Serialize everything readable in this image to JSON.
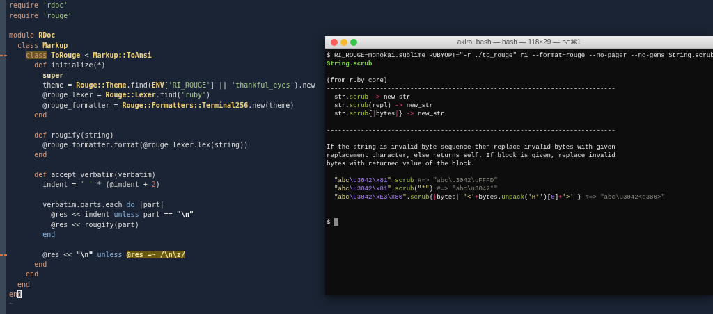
{
  "editor": {
    "lines": [
      {
        "kind": "code",
        "changed": false,
        "tokens": [
          {
            "text": "require",
            "kind": "keyword"
          },
          {
            "text": " 'rdoc'",
            "kind": "string"
          }
        ]
      },
      {
        "kind": "code",
        "changed": false,
        "tokens": [
          {
            "text": "require",
            "kind": "keyword"
          },
          {
            "text": " 'rouge'",
            "kind": "string"
          }
        ]
      },
      {
        "kind": "blank"
      },
      {
        "kind": "code",
        "changed": false,
        "tokens": [
          {
            "text": "module",
            "kind": "keyword"
          },
          {
            "text": " RDoc",
            "kind": "const"
          }
        ]
      },
      {
        "kind": "code",
        "changed": false,
        "tokens": [
          {
            "text": "  class",
            "kind": "keyword"
          },
          {
            "text": " Markup",
            "kind": "const"
          }
        ]
      },
      {
        "kind": "code",
        "changed": true,
        "tokens": [
          {
            "text": "    class",
            "kind": "match-keyword"
          },
          {
            "text": " ToRouge",
            "kind": "const"
          },
          {
            "text": " < ",
            "kind": "plain"
          },
          {
            "text": "Markup::ToAnsi",
            "kind": "const"
          }
        ]
      },
      {
        "kind": "code",
        "changed": false,
        "tokens": [
          {
            "text": "      def",
            "kind": "keyword"
          },
          {
            "text": " initialize(*)",
            "kind": "plain"
          }
        ]
      },
      {
        "kind": "code",
        "changed": false,
        "tokens": [
          {
            "text": "        super",
            "kind": "bold"
          }
        ]
      },
      {
        "kind": "code",
        "changed": false,
        "tokens": [
          {
            "text": "        theme = ",
            "kind": "plain"
          },
          {
            "text": "Rouge::Theme",
            "kind": "const"
          },
          {
            "text": ".find(",
            "kind": "plain"
          },
          {
            "text": "ENV",
            "kind": "const"
          },
          {
            "text": "[",
            "kind": "plain"
          },
          {
            "text": "'RI_ROUGE'",
            "kind": "string"
          },
          {
            "text": "] || ",
            "kind": "plain"
          },
          {
            "text": "'thankful_eyes'",
            "kind": "string"
          },
          {
            "text": ").new",
            "kind": "plain"
          }
        ]
      },
      {
        "kind": "code",
        "changed": false,
        "tokens": [
          {
            "text": "        @rouge_lexer = ",
            "kind": "plain"
          },
          {
            "text": "Rouge::Lexer",
            "kind": "const"
          },
          {
            "text": ".find(",
            "kind": "plain"
          },
          {
            "text": "'ruby'",
            "kind": "string"
          },
          {
            "text": ")",
            "kind": "plain"
          }
        ]
      },
      {
        "kind": "code",
        "changed": false,
        "tokens": [
          {
            "text": "        @rouge_formatter = ",
            "kind": "plain"
          },
          {
            "text": "Rouge::Formatters::Terminal256",
            "kind": "const"
          },
          {
            "text": ".new(theme)",
            "kind": "plain"
          }
        ]
      },
      {
        "kind": "code",
        "changed": false,
        "tokens": [
          {
            "text": "      end",
            "kind": "keyword"
          }
        ]
      },
      {
        "kind": "blank"
      },
      {
        "kind": "code",
        "changed": false,
        "tokens": [
          {
            "text": "      def",
            "kind": "keyword"
          },
          {
            "text": " rougify(string)",
            "kind": "plain"
          }
        ]
      },
      {
        "kind": "code",
        "changed": false,
        "tokens": [
          {
            "text": "        @rouge_formatter.format(@rouge_lexer.lex(string))",
            "kind": "plain"
          }
        ]
      },
      {
        "kind": "code",
        "changed": false,
        "tokens": [
          {
            "text": "      end",
            "kind": "keyword"
          }
        ]
      },
      {
        "kind": "blank"
      },
      {
        "kind": "code",
        "changed": false,
        "tokens": [
          {
            "text": "      def",
            "kind": "keyword"
          },
          {
            "text": " accept_verbatim(verbatim)",
            "kind": "plain"
          }
        ]
      },
      {
        "kind": "code",
        "changed": false,
        "tokens": [
          {
            "text": "        indent = ",
            "kind": "plain"
          },
          {
            "text": "' '",
            "kind": "string"
          },
          {
            "text": " * (@indent + ",
            "kind": "plain"
          },
          {
            "text": "2",
            "kind": "number"
          },
          {
            "text": ")",
            "kind": "plain"
          }
        ]
      },
      {
        "kind": "blank"
      },
      {
        "kind": "code",
        "changed": false,
        "tokens": [
          {
            "text": "        verbatim.parts.each ",
            "kind": "plain"
          },
          {
            "text": "do",
            "kind": "flow"
          },
          {
            "text": " |part|",
            "kind": "plain"
          }
        ]
      },
      {
        "kind": "code",
        "changed": false,
        "tokens": [
          {
            "text": "          @res << indent ",
            "kind": "plain"
          },
          {
            "text": "unless",
            "kind": "flow"
          },
          {
            "text": " part == ",
            "kind": "plain"
          },
          {
            "text": "\"\\n\"",
            "kind": "escape"
          }
        ]
      },
      {
        "kind": "code",
        "changed": false,
        "tokens": [
          {
            "text": "          @res << rougify(part)",
            "kind": "plain"
          }
        ]
      },
      {
        "kind": "code",
        "changed": false,
        "tokens": [
          {
            "text": "        end",
            "kind": "flow"
          }
        ]
      },
      {
        "kind": "blank"
      },
      {
        "kind": "code",
        "changed": true,
        "tokens": [
          {
            "text": "        @res << ",
            "kind": "plain"
          },
          {
            "text": "\"\\n\"",
            "kind": "escape"
          },
          {
            "text": " unless ",
            "kind": "flow"
          },
          {
            "text": "@res =~ /\\n\\z/",
            "kind": "match"
          }
        ]
      },
      {
        "kind": "code",
        "changed": false,
        "tokens": [
          {
            "text": "      end",
            "kind": "keyword"
          }
        ]
      },
      {
        "kind": "code",
        "changed": false,
        "tokens": [
          {
            "text": "    end",
            "kind": "keyword"
          }
        ]
      },
      {
        "kind": "code",
        "changed": false,
        "tokens": [
          {
            "text": "  end",
            "kind": "keyword"
          }
        ]
      },
      {
        "kind": "code",
        "changed": false,
        "tokens": [
          {
            "text": "en",
            "kind": "keyword"
          },
          {
            "text": "d",
            "kind": "cursor"
          }
        ]
      },
      {
        "kind": "tilde",
        "changed": false,
        "tokens": [
          {
            "text": "~",
            "kind": "dim"
          }
        ]
      }
    ]
  },
  "terminal": {
    "title": "akira: bash — bash — 118×29 — ⌥⌘1",
    "lines": [
      {
        "kind": "text",
        "tokens": [
          {
            "text": "$ RI_ROUGE=monokai.sublime RUBYOPT=\"-r ./to_rouge\" ri --format=rouge --no-pager --no-gems String.scrub",
            "kind": "plain"
          }
        ]
      },
      {
        "kind": "text",
        "tokens": [
          {
            "text": "String.scrub",
            "kind": "heading"
          }
        ]
      },
      {
        "kind": "blank"
      },
      {
        "kind": "text",
        "tokens": [
          {
            "text": "(from ruby core)",
            "kind": "plain"
          }
        ]
      },
      {
        "kind": "text",
        "tokens": [
          {
            "text": "----------------------------------------------------------------------------",
            "kind": "plain"
          }
        ]
      },
      {
        "kind": "text",
        "tokens": [
          {
            "text": "  str.",
            "kind": "plain"
          },
          {
            "text": "scrub",
            "kind": "method"
          },
          {
            "text": " -> ",
            "kind": "op"
          },
          {
            "text": "new_str",
            "kind": "plain"
          }
        ]
      },
      {
        "kind": "text",
        "tokens": [
          {
            "text": "  str.",
            "kind": "plain"
          },
          {
            "text": "scrub",
            "kind": "method"
          },
          {
            "text": "(repl)",
            "kind": "plain"
          },
          {
            "text": " -> ",
            "kind": "op"
          },
          {
            "text": "new_str",
            "kind": "plain"
          }
        ]
      },
      {
        "kind": "text",
        "tokens": [
          {
            "text": "  str.",
            "kind": "plain"
          },
          {
            "text": "scrub",
            "kind": "method"
          },
          {
            "text": "{",
            "kind": "plain"
          },
          {
            "text": "|",
            "kind": "op"
          },
          {
            "text": "bytes",
            "kind": "plain"
          },
          {
            "text": "|",
            "kind": "op"
          },
          {
            "text": "}",
            "kind": "plain"
          },
          {
            "text": " -> ",
            "kind": "op"
          },
          {
            "text": "new_str",
            "kind": "plain"
          }
        ]
      },
      {
        "kind": "blank"
      },
      {
        "kind": "text",
        "tokens": [
          {
            "text": "----------------------------------------------------------------------------",
            "kind": "plain"
          }
        ]
      },
      {
        "kind": "blank"
      },
      {
        "kind": "text",
        "tokens": [
          {
            "text": "If the string is invalid byte sequence then replace invalid bytes with given",
            "kind": "plain"
          }
        ]
      },
      {
        "kind": "text",
        "tokens": [
          {
            "text": "replacement character, else returns self. If block is given, replace invalid",
            "kind": "plain"
          }
        ]
      },
      {
        "kind": "text",
        "tokens": [
          {
            "text": "bytes with returned value of the block.",
            "kind": "plain"
          }
        ]
      },
      {
        "kind": "blank"
      },
      {
        "kind": "text",
        "tokens": [
          {
            "text": "  \"abc",
            "kind": "string"
          },
          {
            "text": "\\u3042\\x81",
            "kind": "escape"
          },
          {
            "text": "\"",
            "kind": "string"
          },
          {
            "text": ".",
            "kind": "plain"
          },
          {
            "text": "scrub",
            "kind": "method"
          },
          {
            "text": " #=> \"abc\\u3042\\uFFFD\"",
            "kind": "comment"
          }
        ]
      },
      {
        "kind": "text",
        "tokens": [
          {
            "text": "  \"abc",
            "kind": "string"
          },
          {
            "text": "\\u3042\\x81",
            "kind": "escape"
          },
          {
            "text": "\"",
            "kind": "string"
          },
          {
            "text": ".",
            "kind": "plain"
          },
          {
            "text": "scrub",
            "kind": "method"
          },
          {
            "text": "(",
            "kind": "plain"
          },
          {
            "text": "\"*\"",
            "kind": "string"
          },
          {
            "text": ")",
            "kind": "plain"
          },
          {
            "text": " #=> \"abc\\u3042*\"",
            "kind": "comment"
          }
        ]
      },
      {
        "kind": "text",
        "tokens": [
          {
            "text": "  \"abc",
            "kind": "string"
          },
          {
            "text": "\\u3042\\xE3\\x80",
            "kind": "escape"
          },
          {
            "text": "\"",
            "kind": "string"
          },
          {
            "text": ".",
            "kind": "plain"
          },
          {
            "text": "scrub",
            "kind": "method"
          },
          {
            "text": "{",
            "kind": "plain"
          },
          {
            "text": "|",
            "kind": "op"
          },
          {
            "text": "bytes",
            "kind": "plain"
          },
          {
            "text": "|",
            "kind": "op"
          },
          {
            "text": " '<'",
            "kind": "string"
          },
          {
            "text": "+",
            "kind": "op"
          },
          {
            "text": "bytes.",
            "kind": "plain"
          },
          {
            "text": "unpack",
            "kind": "method"
          },
          {
            "text": "(",
            "kind": "plain"
          },
          {
            "text": "'H*'",
            "kind": "string"
          },
          {
            "text": ")[",
            "kind": "plain"
          },
          {
            "text": "0",
            "kind": "escape"
          },
          {
            "text": "]",
            "kind": "plain"
          },
          {
            "text": "+",
            "kind": "op"
          },
          {
            "text": "'>'",
            "kind": "string"
          },
          {
            "text": " } ",
            "kind": "plain"
          },
          {
            "text": "#=> \"abc\\u3042<e380>\"",
            "kind": "comment"
          }
        ]
      },
      {
        "kind": "blank"
      },
      {
        "kind": "blank"
      },
      {
        "kind": "prompt",
        "tokens": [
          {
            "text": "$",
            "kind": "plain"
          }
        ]
      }
    ]
  }
}
